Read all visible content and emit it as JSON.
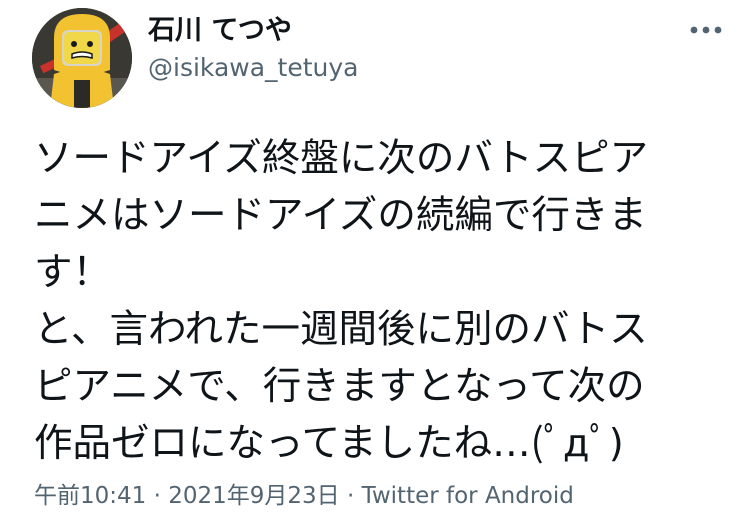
{
  "author": {
    "display_name": "石川 てつや",
    "handle": "@isikawa_tetuya",
    "avatar_icon": "hazmat-minifigure-avatar"
  },
  "menu": {
    "more_icon": "more-horizontal-icon"
  },
  "tweet": {
    "lines": [
      "ソードアイズ終盤に次のバトスピア",
      "ニメはソードアイズの続編で行きま",
      "す！",
      "と、言われた一週間後に別のバトス",
      "ピアニメで、行きますとなって次の",
      "作品ゼロになってましたね…(ﾟдﾟ)"
    ]
  },
  "meta": {
    "time": "午前10:41",
    "separator_1": "·",
    "date": "2021年9月23日",
    "separator_2": "·",
    "source": "Twitter for Android"
  },
  "colors": {
    "text_primary": "#0f1419",
    "text_secondary": "#536471",
    "avatar_suit": "#f2c230"
  }
}
